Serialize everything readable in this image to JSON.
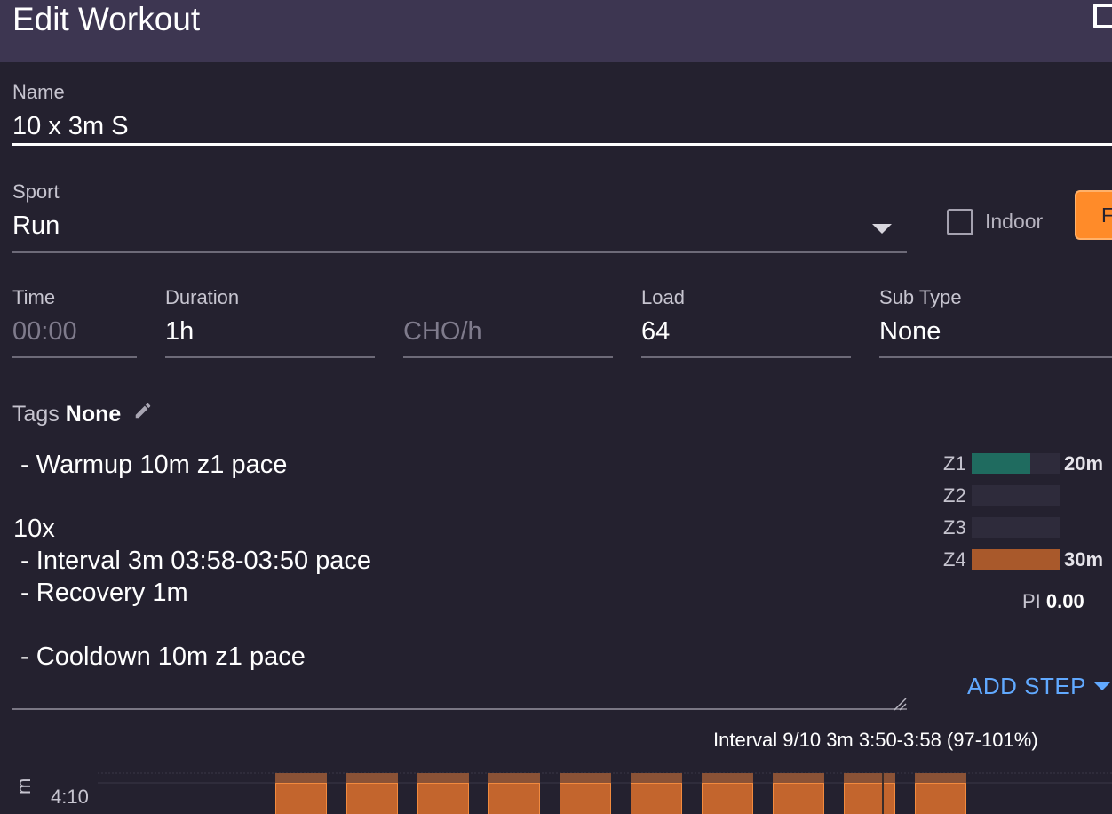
{
  "window": {
    "title": "Edit Workout"
  },
  "form": {
    "name": {
      "label": "Name",
      "value": "10 x 3m S"
    },
    "sport": {
      "label": "Sport",
      "value": "Run"
    },
    "indoor": {
      "label": "Indoor",
      "checked": false
    },
    "orange_button": {
      "label": "F"
    },
    "time": {
      "label": "Time",
      "placeholder": "00:00"
    },
    "duration": {
      "label": "Duration",
      "value": "1h"
    },
    "cho": {
      "placeholder": "CHO/h"
    },
    "load": {
      "label": "Load",
      "value": "64"
    },
    "subtype": {
      "label": "Sub Type",
      "value": "None"
    },
    "tags": {
      "label": "Tags",
      "value": "None"
    }
  },
  "description": {
    "text": " - Warmup 10m z1 pace\n\n10x\n - Interval 3m 03:58-03:50 pace\n - Recovery 1m\n\n - Cooldown 10m z1 pace"
  },
  "zones": [
    {
      "label": "Z1",
      "duration": "20m",
      "fraction": 0.66,
      "color": "#1f6b5f"
    },
    {
      "label": "Z2",
      "duration": "",
      "fraction": 0,
      "color": "#1f6b5f"
    },
    {
      "label": "Z3",
      "duration": "",
      "fraction": 0,
      "color": "#1f6b5f"
    },
    {
      "label": "Z4",
      "duration": "30m",
      "fraction": 1.0,
      "color": "#a9592b"
    }
  ],
  "pi": {
    "label": "PI",
    "value": "0.00"
  },
  "add_step": {
    "label": "ADD STEP"
  },
  "chart": {
    "tooltip": "Interval 9/10  3m  3:50-3:58 (97-101%)",
    "y_tick": "4:10",
    "y_label": "m",
    "interval_count": 10,
    "highlight_index": 8,
    "colors": {
      "bar": "#c3652d",
      "bar_border": "#f28a3e",
      "bar_top": "#8a5236",
      "hover_line": "#3a2d2a"
    }
  }
}
